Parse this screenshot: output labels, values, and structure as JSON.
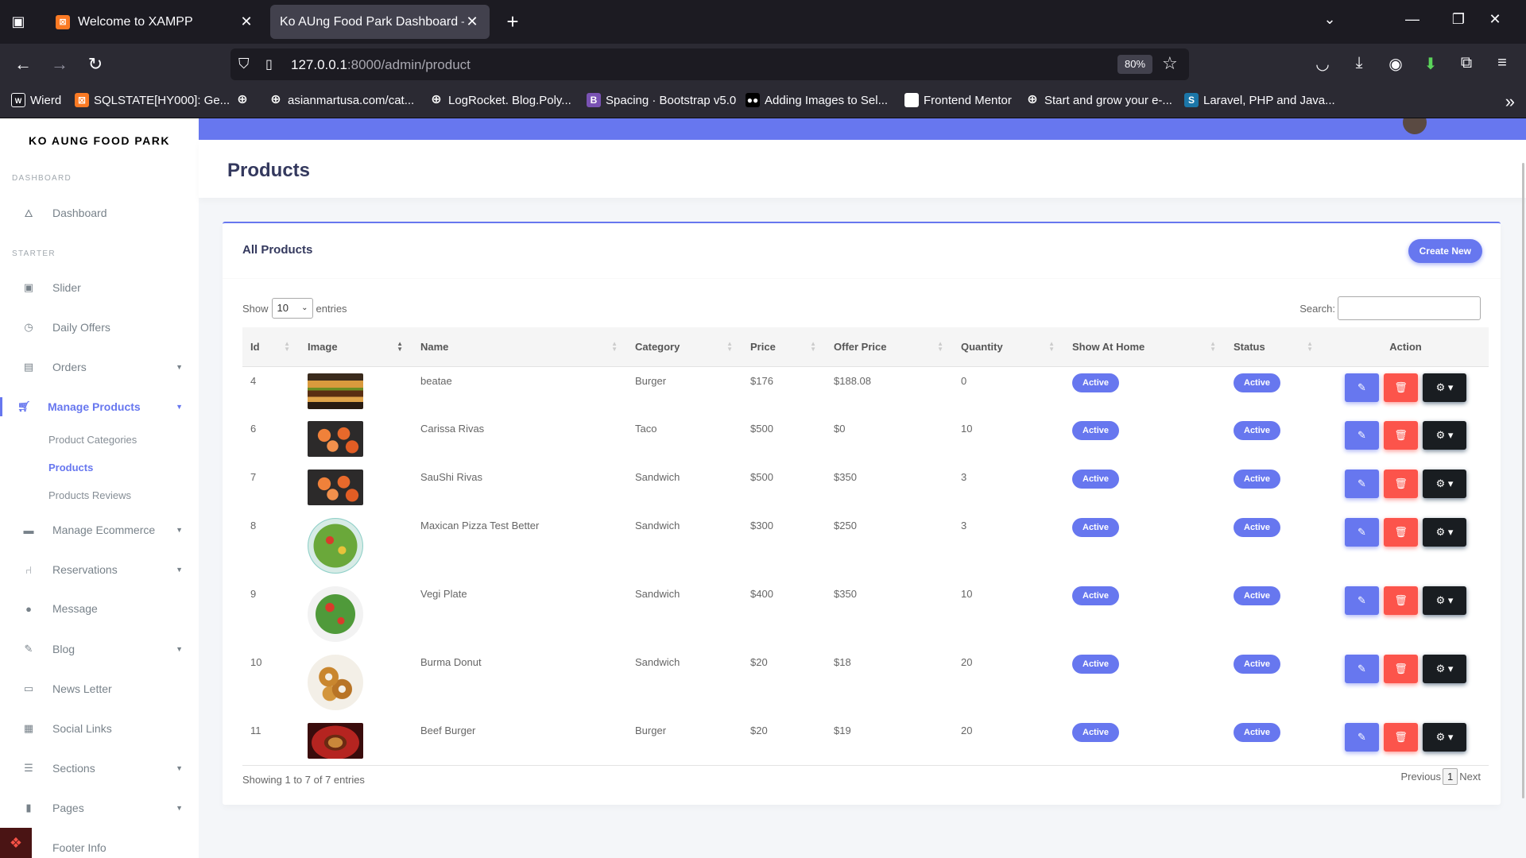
{
  "browser": {
    "tabs": [
      {
        "title": "Welcome to XAMPP",
        "icon": "xampp-icon"
      },
      {
        "title": "Ko AUng Food Park Dashboard — S",
        "icon": "none"
      }
    ],
    "url_host": "127.0.0.1",
    "url_rest": ":8000/admin/product",
    "zoom": "80%",
    "bookmarks": [
      {
        "label": "Wierd",
        "icon": "laravel-icon",
        "color": "#1c1b22"
      },
      {
        "label": "SQLSTATE[HY000]: Ge...",
        "icon": "xampp-icon",
        "color": "#fb7a24"
      },
      {
        "label": "",
        "icon": "globe-icon",
        "color": ""
      },
      {
        "label": "asianmartusa.com/cat...",
        "icon": "globe-icon",
        "color": ""
      },
      {
        "label": "LogRocket. Blog.Poly...",
        "icon": "globe-icon",
        "color": ""
      },
      {
        "label": "Spacing · Bootstrap v5.0",
        "icon": "bootstrap-icon",
        "color": "#7952b3"
      },
      {
        "label": "Adding Images to Sel...",
        "icon": "medium-icon",
        "color": "#000000"
      },
      {
        "label": "Frontend Mentor",
        "icon": "page-icon",
        "color": "#ffffff"
      },
      {
        "label": "Start and grow your e-...",
        "icon": "globe-icon",
        "color": ""
      },
      {
        "label": "Laravel, PHP and Java...",
        "icon": "s-icon",
        "color": "#1b76a8"
      }
    ]
  },
  "sidebar": {
    "brand": "KO AUNG FOOD PARK",
    "headers": {
      "dashboard": "DASHBOARD",
      "starter": "STARTER"
    },
    "items": {
      "dashboard": "Dashboard",
      "slider": "Slider",
      "daily_offers": "Daily Offers",
      "orders": "Orders",
      "manage_products": "Manage Products",
      "product_categories": "Product Categories",
      "products": "Products",
      "products_reviews": "Products Reviews",
      "manage_ecommerce": "Manage Ecommerce",
      "reservations": "Reservations",
      "message": "Message",
      "blog": "Blog",
      "news_letter": "News Letter",
      "social_links": "Social Links",
      "sections": "Sections",
      "pages": "Pages",
      "footer_info": "Footer Info"
    }
  },
  "page": {
    "title": "Products",
    "card_title": "All Products",
    "create_button": "Create New",
    "length": {
      "show": "Show",
      "value": "10",
      "entries": "entries"
    },
    "search_label": "Search:",
    "info": "Showing 1 to 7 of 7 entries",
    "paging": {
      "previous": "Previous",
      "current": "1",
      "next": "Next"
    }
  },
  "table": {
    "columns": [
      "Id",
      "Image",
      "Name",
      "Category",
      "Price",
      "Offer Price",
      "Quantity",
      "Show At Home",
      "Status",
      "Action"
    ],
    "rows": [
      {
        "id": "4",
        "name": "beatae",
        "category": "Burger",
        "price": "$176",
        "offer": "$188.08",
        "qty": "0",
        "home": "Active",
        "status": "Active",
        "image": "burger"
      },
      {
        "id": "6",
        "name": "Carissa Rivas",
        "category": "Taco",
        "price": "$500",
        "offer": "$0",
        "qty": "10",
        "home": "Active",
        "status": "Active",
        "image": "shrimp"
      },
      {
        "id": "7",
        "name": "SauShi Rivas",
        "category": "Sandwich",
        "price": "$500",
        "offer": "$350",
        "qty": "3",
        "home": "Active",
        "status": "Active",
        "image": "shrimp"
      },
      {
        "id": "8",
        "name": "Maxican Pizza Test Better",
        "category": "Sandwich",
        "price": "$300",
        "offer": "$250",
        "qty": "3",
        "home": "Active",
        "status": "Active",
        "image": "salad"
      },
      {
        "id": "9",
        "name": "Vegi Plate",
        "category": "Sandwich",
        "price": "$400",
        "offer": "$350",
        "qty": "10",
        "home": "Active",
        "status": "Active",
        "image": "salad-plate"
      },
      {
        "id": "10",
        "name": "Burma Donut",
        "category": "Sandwich",
        "price": "$20",
        "offer": "$18",
        "qty": "20",
        "home": "Active",
        "status": "Active",
        "image": "donut"
      },
      {
        "id": "11",
        "name": "Beef Burger",
        "category": "Burger",
        "price": "$20",
        "offer": "$19",
        "qty": "20",
        "home": "Active",
        "status": "Active",
        "image": "burger-dark"
      }
    ]
  },
  "colors": {
    "primary": "#6777ef",
    "danger": "#fc544b",
    "dark": "#191d21"
  }
}
